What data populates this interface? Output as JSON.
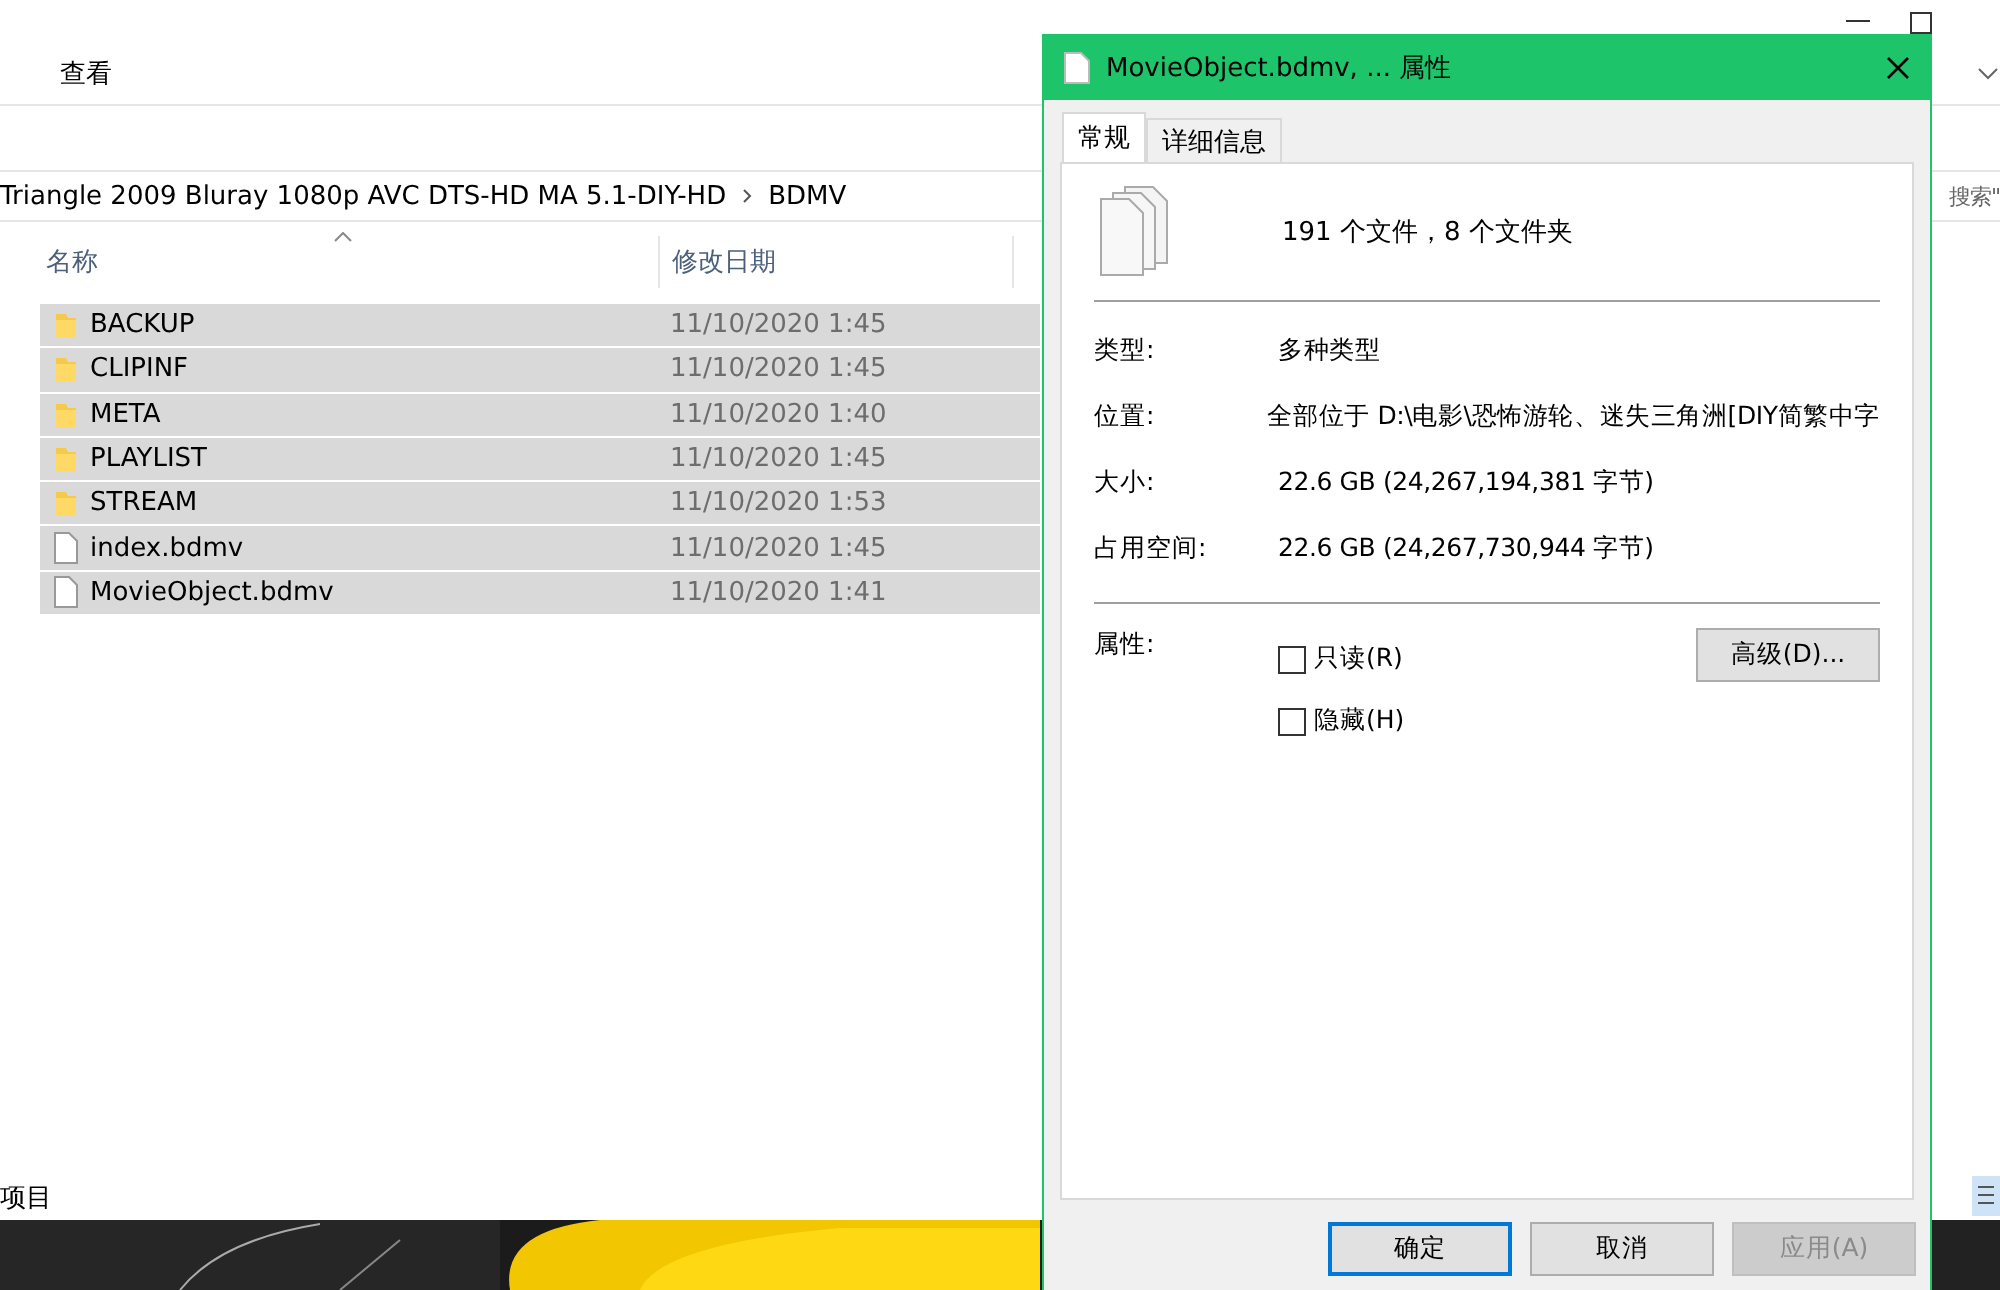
{
  "explorer": {
    "menu": [
      {
        "label": "查看"
      }
    ],
    "address": {
      "path": [
        "Triangle 2009 Bluray 1080p AVC DTS-HD MA 5.1-DIY-HD",
        "BDMV"
      ]
    },
    "search": {
      "placeholder": "搜索\""
    },
    "columns": [
      {
        "label": "名称",
        "sorted": true
      },
      {
        "label": "修改日期",
        "sorted": false
      }
    ],
    "rows": [
      {
        "kind": "folder",
        "name": "BACKUP",
        "date": "11/10/2020 1:45",
        "selected": true
      },
      {
        "kind": "folder",
        "name": "CLIPINF",
        "date": "11/10/2020 1:45",
        "selected": true
      },
      {
        "kind": "folder",
        "name": "META",
        "date": "11/10/2020 1:40",
        "selected": true
      },
      {
        "kind": "folder",
        "name": "PLAYLIST",
        "date": "11/10/2020 1:45",
        "selected": true
      },
      {
        "kind": "folder",
        "name": "STREAM",
        "date": "11/10/2020 1:53",
        "selected": true
      },
      {
        "kind": "file",
        "name": "index.bdmv",
        "date": "11/10/2020 1:45",
        "selected": true
      },
      {
        "kind": "file",
        "name": "MovieObject.bdmv",
        "date": "11/10/2020 1:41",
        "selected": true
      }
    ],
    "status_bar": "项目"
  },
  "dialog": {
    "title": "MovieObject.bdmv, ... 属性",
    "tabs": [
      {
        "label": "常规",
        "selected": true
      },
      {
        "label": "详细信息",
        "selected": false
      }
    ],
    "summary": "191 个文件，8 个文件夹",
    "properties": [
      {
        "label": "类型:",
        "value": "多种类型"
      },
      {
        "label": "位置:",
        "value": "全部位于 D:\\电影\\恐怖游轮、迷失三角洲[DIY简繁中字"
      },
      {
        "label": "大小:",
        "value": "22.6 GB (24,267,194,381 字节)"
      },
      {
        "label": "占用空间:",
        "value": "22.6 GB (24,267,730,944 字节)"
      }
    ],
    "attributes_label": "属性:",
    "attributes": [
      {
        "label": "只读(R)",
        "checked": false
      },
      {
        "label": "隐藏(H)",
        "checked": false
      }
    ],
    "advanced_button": "高级(D)...",
    "buttons": [
      {
        "label": "确定",
        "default": true,
        "disabled": false
      },
      {
        "label": "取消",
        "default": false,
        "disabled": false
      },
      {
        "label": "应用(A)",
        "default": false,
        "disabled": true
      }
    ]
  }
}
